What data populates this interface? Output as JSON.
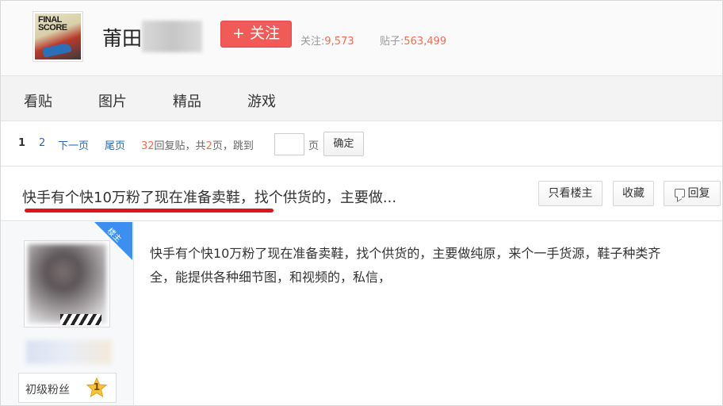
{
  "header": {
    "forum_logo_text": "FINAL SCORE",
    "forum_name": "莆田",
    "follow_label": "+ 关注",
    "stats": {
      "follow_label": "关注:",
      "follow_count": "9,573",
      "posts_label": "贴子:",
      "posts_count": "563,499"
    }
  },
  "nav": {
    "items": [
      {
        "label": "看贴"
      },
      {
        "label": "图片"
      },
      {
        "label": "精品"
      },
      {
        "label": "游戏"
      }
    ]
  },
  "pager": {
    "current_page": "1",
    "page_2": "2",
    "next_page": "下一页",
    "last_page": "尾页",
    "reply_count": "32",
    "reply_suffix": "回复贴，共",
    "total_pages": "2",
    "pages_suffix": "页，跳到",
    "jump_input_value": "",
    "page_unit": "页",
    "confirm": "确定"
  },
  "thread": {
    "title": "快手有个快10万粉了现在准备卖鞋，找个供货的，主要做...",
    "only_op": "只看楼主",
    "favorite": "收藏",
    "reply": "回复"
  },
  "post": {
    "louzhu_badge": "楼主",
    "content_line1": "快手有个快10万粉了现在准备卖鞋，找个供货的，主要做纯原，来个一手货源，鞋子种类齐",
    "content_line2": "全，能提供各种细节图，和视频的，私信，",
    "author_level_label": "初级粉丝",
    "author_level_number": "1"
  },
  "colors": {
    "follow_button": "#f15b57",
    "stat_number": "#f26c4f",
    "link": "#2d64b3",
    "highlight_underline": "#e1141c",
    "louzhu_badge": "#3c8ff0"
  }
}
